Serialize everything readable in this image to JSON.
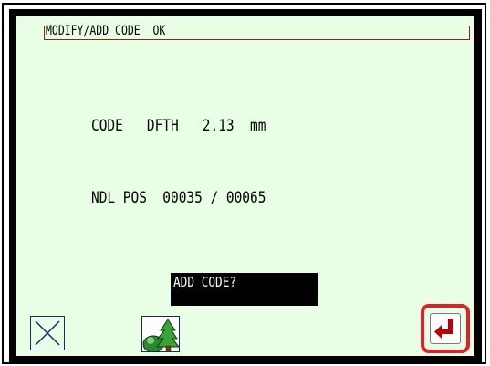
{
  "title": {
    "text": "MODIFY/ADD CODE  OK"
  },
  "code_row": {
    "text": "CODE   DFTH   2.13  mm"
  },
  "ndl_row": {
    "text": "NDL POS  00035 / 00065"
  },
  "prompt": {
    "text": "ADD CODE?"
  },
  "buttons": {
    "close": {
      "icon": "close-icon"
    },
    "tree": {
      "icon": "tree-landscape-icon"
    },
    "enter": {
      "icon": "enter-return-icon",
      "accent": "#e0202a"
    }
  },
  "colors": {
    "screen_bg": "#e9ffe5",
    "highlight": "#e0202a",
    "enter_arrow": "#c00000"
  }
}
